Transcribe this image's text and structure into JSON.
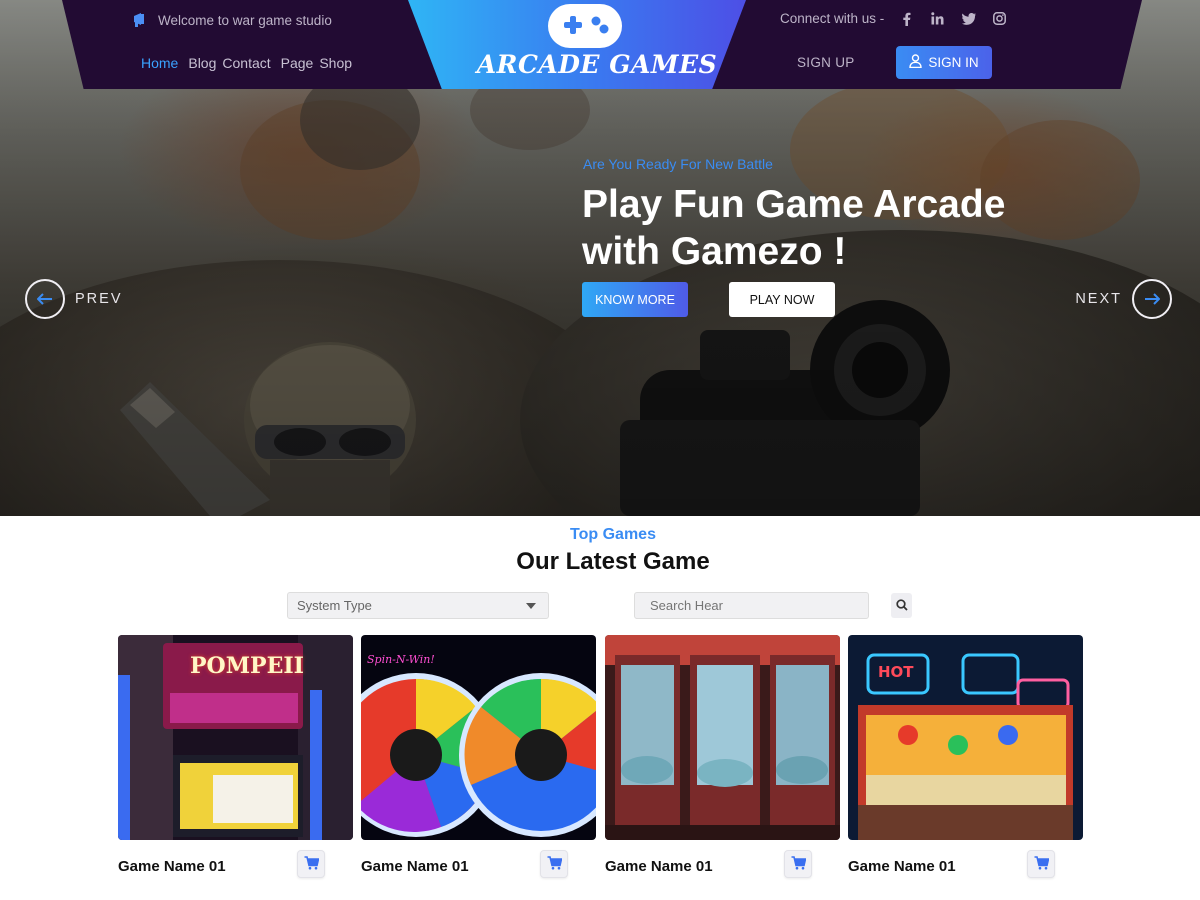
{
  "header": {
    "welcome_text": "Welcome to war game studio",
    "logo_text": "ARCADE GAMES",
    "nav": [
      {
        "label": "Home",
        "active": true
      },
      {
        "label": "Blog",
        "active": false
      },
      {
        "label": "Contact",
        "active": false
      },
      {
        "label": "Page",
        "active": false
      },
      {
        "label": "Shop",
        "active": false
      }
    ],
    "connect_text": "Connect with us -",
    "social_icons": [
      "facebook-icon",
      "linkedin-icon",
      "twitter-icon",
      "instagram-icon"
    ],
    "signup_label": "SIGN UP",
    "signin_label": "SIGN IN"
  },
  "hero": {
    "eyebrow": "Are You Ready For New Battle",
    "headline_line1": "Play Fun Game Arcade",
    "headline_line2": "with Gamezo !",
    "know_more_label": "KNOW MORE",
    "play_now_label": "PLAY NOW",
    "prev_label": "PREV",
    "next_label": "NEXT"
  },
  "games_section": {
    "eyebrow": "Top Games",
    "title": "Our Latest Game",
    "system_select": {
      "value": "System Type"
    },
    "search": {
      "placeholder": "Search Hear"
    },
    "cards": [
      {
        "name": "Game Name 01",
        "image": "slot-machine",
        "image_text": "POMPEII"
      },
      {
        "name": "Game Name 01",
        "image": "spin-wheels",
        "image_text": "Spin-N-Win!"
      },
      {
        "name": "Game Name 01",
        "image": "claw-machines",
        "image_text": ""
      },
      {
        "name": "Game Name 01",
        "image": "neon-arcade-booth",
        "image_text": "HOT"
      }
    ]
  },
  "colors": {
    "accent": "#3a8cf3",
    "topbar": "#220b33",
    "button_gradient_start": "#2fa8f5",
    "button_gradient_end": "#4f5be8"
  }
}
